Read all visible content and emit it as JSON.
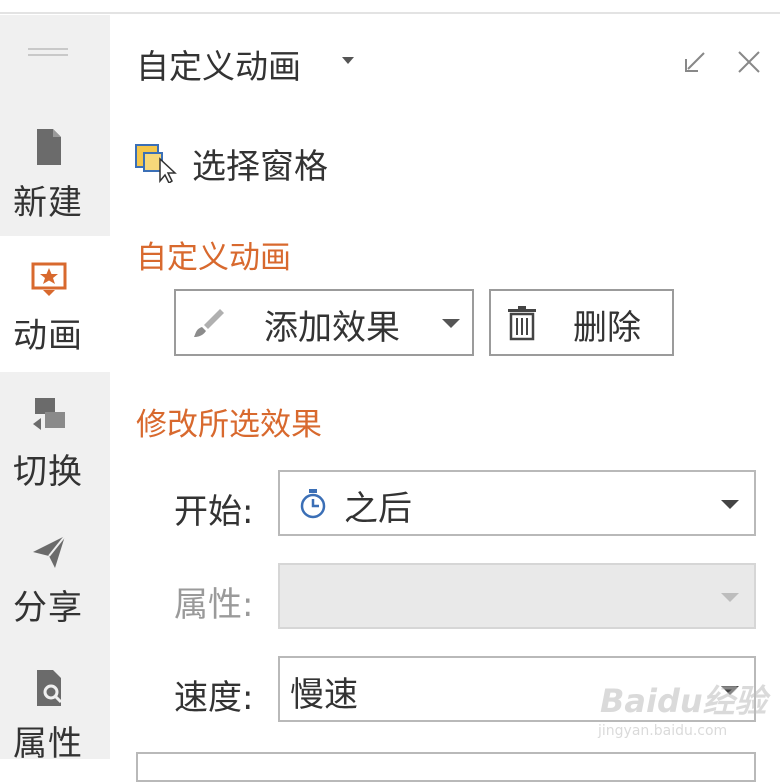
{
  "sidebar": {
    "items": [
      {
        "label": "新建",
        "icon": "document-icon",
        "active": false
      },
      {
        "label": "动画",
        "icon": "animation-icon",
        "active": true
      },
      {
        "label": "切换",
        "icon": "transition-icon",
        "active": false
      },
      {
        "label": "分享",
        "icon": "share-icon",
        "active": false
      },
      {
        "label": "属性",
        "icon": "properties-icon",
        "active": false
      }
    ]
  },
  "panel": {
    "title": "自定义动画",
    "selection_pane_label": "选择窗格",
    "section_custom_animation": "自定义动画",
    "add_effect_label": "添加效果",
    "delete_label": "删除",
    "section_modify": "修改所选效果",
    "fields": {
      "start": {
        "label": "开始:",
        "value": "之后"
      },
      "property": {
        "label": "属性:",
        "value": ""
      },
      "speed": {
        "label": "速度:",
        "value": "慢速"
      }
    }
  },
  "watermark": {
    "brand": "Baidu经验",
    "url": "jingyan.baidu.com"
  },
  "colors": {
    "accent": "#d8692e",
    "sidebar_bg": "#f0f0f0",
    "border": "#9b9b9b",
    "disabled_bg": "#e9e9e9"
  }
}
